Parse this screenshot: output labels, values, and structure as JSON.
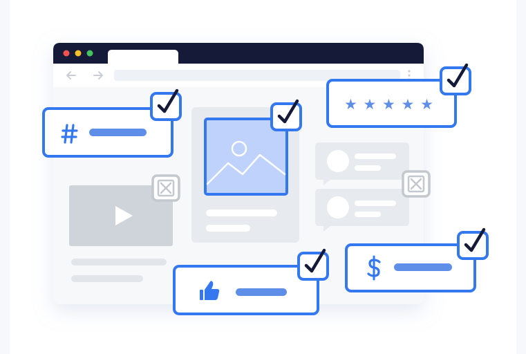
{
  "illustration": {
    "browser": {
      "traffic_lights": [
        "#ef5350",
        "#f6c026",
        "#45c35e"
      ],
      "nav_icons": [
        "back-arrow-icon",
        "forward-arrow-icon",
        "more-dots-icon"
      ]
    },
    "rating": {
      "stars": 5,
      "glyph": "★"
    },
    "approved_items": [
      "hashtag",
      "image",
      "rating",
      "like",
      "price"
    ],
    "rejected_items": [
      "video",
      "comments"
    ],
    "colors": {
      "accent": "#3478f0",
      "accent_light": "#bed2fb",
      "muted": "#e7eaee",
      "muted_dark": "#cfd4da",
      "reject": "#c3c8cf",
      "browser_bar": "#151a38",
      "check": "#151a38"
    }
  }
}
